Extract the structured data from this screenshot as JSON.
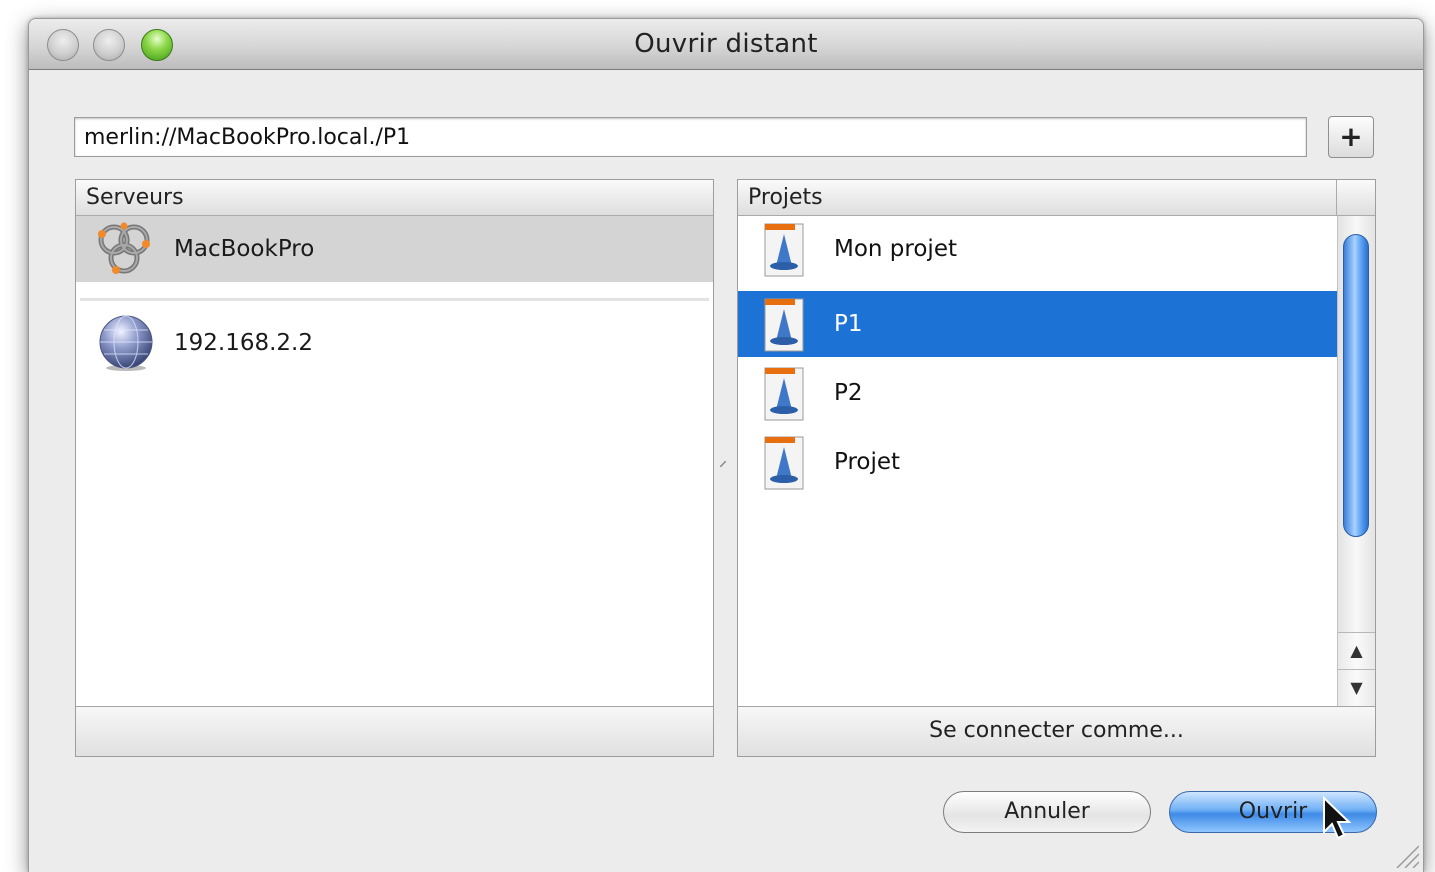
{
  "window": {
    "title": "Ouvrir distant"
  },
  "address": {
    "value": "merlin://MacBookPro.local./P1"
  },
  "add_button": {
    "label": "+"
  },
  "servers": {
    "header": "Serveurs",
    "items": [
      {
        "label": "MacBookPro",
        "icon": "bonjour-network-icon",
        "selected": true
      },
      {
        "label": "192.168.2.2",
        "icon": "network-globe-icon",
        "selected": false
      }
    ]
  },
  "projects": {
    "header": "Projets",
    "items": [
      {
        "label": "Mon projet",
        "icon": "project-document-icon",
        "selected": false
      },
      {
        "label": "P1",
        "icon": "project-document-icon",
        "selected": true
      },
      {
        "label": "P2",
        "icon": "project-document-icon",
        "selected": false
      },
      {
        "label": "Projet",
        "icon": "project-document-icon",
        "selected": false
      }
    ],
    "connect_label": "Se connecter comme..."
  },
  "buttons": {
    "cancel": "Annuler",
    "open": "Ouvrir"
  },
  "colors": {
    "selection": "#1d72d6",
    "zoom_button": "#58b82a"
  }
}
